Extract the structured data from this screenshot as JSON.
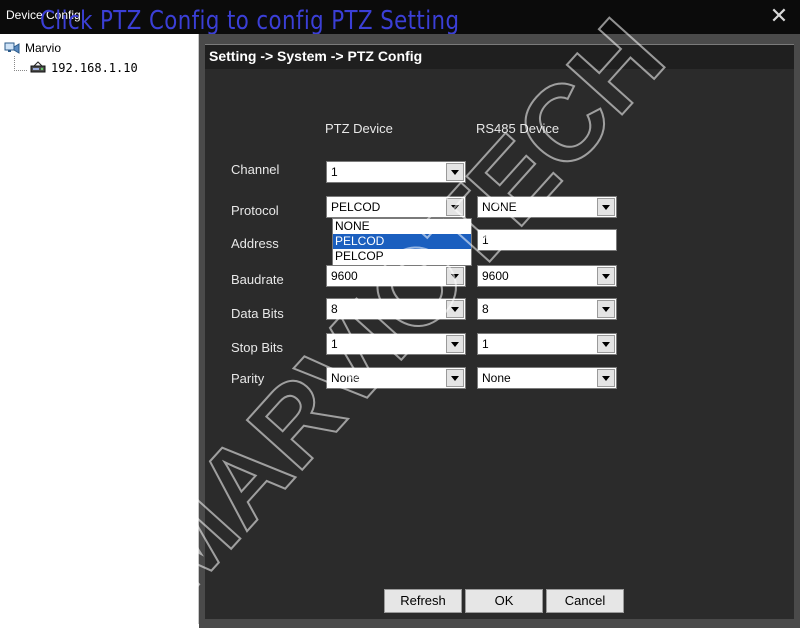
{
  "window": {
    "title": "Device Config",
    "overlay_caption": "Click PTZ Config to config PTZ Setting",
    "close_glyph": "✕"
  },
  "tree": {
    "root_label": "Marvio",
    "root_icon": "device-tree-icon",
    "child_label": "192.168.1.10",
    "child_icon": "dvr-device-icon"
  },
  "breadcrumb": "Setting -> System -> PTZ Config",
  "columns": {
    "ptz_header": "PTZ Device",
    "rs485_header": "RS485 Device"
  },
  "fields": {
    "channel": {
      "label": "Channel",
      "ptz": "1"
    },
    "protocol": {
      "label": "Protocol",
      "ptz": "PELCOD",
      "rs485": "NONE"
    },
    "address": {
      "label": "Address",
      "rs485": "1"
    },
    "baudrate": {
      "label": "Baudrate",
      "ptz": "9600",
      "rs485": "9600"
    },
    "data_bits": {
      "label": "Data Bits",
      "ptz": "8",
      "rs485": "8"
    },
    "stop_bits": {
      "label": "Stop Bits",
      "ptz": "1",
      "rs485": "1"
    },
    "parity": {
      "label": "Parity",
      "ptz": "None",
      "rs485": "None"
    }
  },
  "protocol_dropdown": {
    "options": [
      "NONE",
      "PELCOD",
      "PELCOP"
    ],
    "selected": "PELCOD"
  },
  "buttons": {
    "refresh": "Refresh",
    "ok": "OK",
    "cancel": "Cancel"
  },
  "watermark": "MARVIOTECH",
  "colors": {
    "titlebar": "#0b0b0b",
    "caption": "#3b3fd6",
    "panel": "#2b2b2b",
    "selection": "#1b5fbf"
  }
}
